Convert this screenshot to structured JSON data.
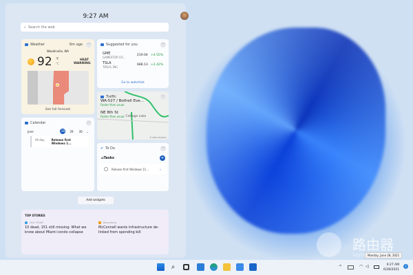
{
  "panel": {
    "time": "9:27 AM",
    "search_placeholder": "Search the web"
  },
  "weather": {
    "title": "Weather",
    "updated": "6m ago",
    "location": "Woodinville, WA",
    "temp": "92",
    "unit_f": "°F",
    "unit_c": "°C",
    "alert": "HEAT WARNING",
    "link": "See full forecast"
  },
  "stocks": {
    "title": "Suggested for you",
    "items": [
      {
        "ticker": "GME",
        "name": "GAMESTOP CO...",
        "price": "219.04",
        "change": "+4.55%"
      },
      {
        "ticker": "TSLA",
        "name": "TESLA, INC.",
        "price": "688.13",
        "change": "+2.42%"
      }
    ],
    "link": "Go to watchlist"
  },
  "traffic": {
    "title": "Traffic",
    "route1": "WA-527 / Bothell Eve...",
    "status1": "Faster than usual",
    "route2": "NE 8th St",
    "status2": "Faster than usual",
    "place": "Cottage Lake",
    "credit": "© 2021 TomTom"
  },
  "calendar": {
    "title": "Calendar",
    "month": "June",
    "days": [
      "28",
      "29",
      "30"
    ],
    "event_time": "All day",
    "event": "Release first Windows 1..."
  },
  "todo": {
    "title": "To Do",
    "list": "Tasks",
    "task": "Release first Windows 11..."
  },
  "add_widgets": "Add widgets",
  "stories": {
    "title": "TOP STORIES",
    "items": [
      {
        "source": "USA TODAY",
        "headline": "10 dead, 151 still missing: What we know about Miami condo collapse"
      },
      {
        "source": "Bloomberg",
        "headline": "McConnell wants infrastructure de-linked from spending bill"
      }
    ]
  },
  "watermark": {
    "text": "路由器",
    "sub": "luyouqi.com"
  },
  "taskbar": {
    "tooltip": "Monday, June 28, 2021",
    "time": "9:27 AM",
    "date": "6/28/2021",
    "notif": "2"
  }
}
